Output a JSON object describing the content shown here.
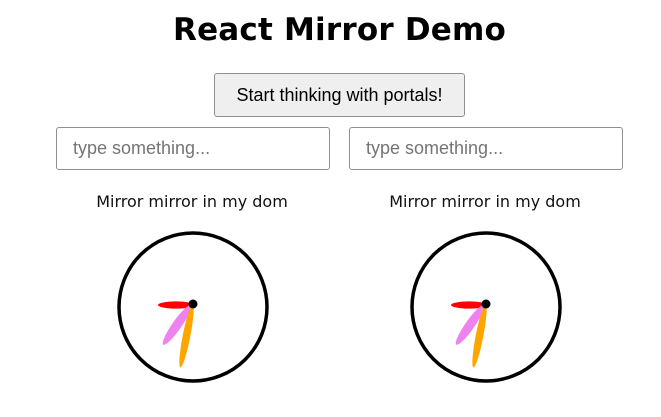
{
  "header": {
    "title": "React Mirror Demo"
  },
  "controls": {
    "portal_button_label": "Start thinking with portals!"
  },
  "inputs": {
    "left": {
      "value": "",
      "placeholder": "type something..."
    },
    "right": {
      "value": "",
      "placeholder": "type something..."
    }
  },
  "mirrors": [
    {
      "caption": "Mirror mirror in my dom"
    },
    {
      "caption": "Mirror mirror in my dom"
    }
  ],
  "colors": {
    "hand_red": "#ff0000",
    "hand_violet": "#ee82ee",
    "hand_orange": "#ffa500",
    "dial_stroke": "#000000"
  }
}
